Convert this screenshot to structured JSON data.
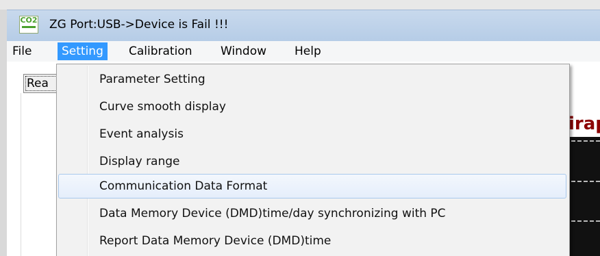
{
  "window": {
    "title": "ZG Port:USB->Device is Fail !!!",
    "icon": "co2-app-icon",
    "icon_text": "CO2"
  },
  "menubar": {
    "items": [
      {
        "label": "File"
      },
      {
        "label": "Setting"
      },
      {
        "label": "Calibration"
      },
      {
        "label": "Window"
      },
      {
        "label": "Help"
      }
    ]
  },
  "tab": {
    "label": "Rea"
  },
  "graph": {
    "label": "irap"
  },
  "dropdown": {
    "items": [
      {
        "label": "Parameter Setting"
      },
      {
        "label": "Curve smooth display"
      },
      {
        "label": "Event analysis"
      },
      {
        "label": "Display range"
      },
      {
        "label": "Communication Data Format"
      },
      {
        "label": "Data Memory Device (DMD)time/day synchronizing with PC"
      },
      {
        "label": "Report Data Memory Device (DMD)time"
      }
    ]
  },
  "colors": {
    "menu_active": "#3399ff",
    "hover_highlight": "#e5eefb",
    "graph_label": "#8b0000",
    "titlebar": "#b4cbe6"
  }
}
